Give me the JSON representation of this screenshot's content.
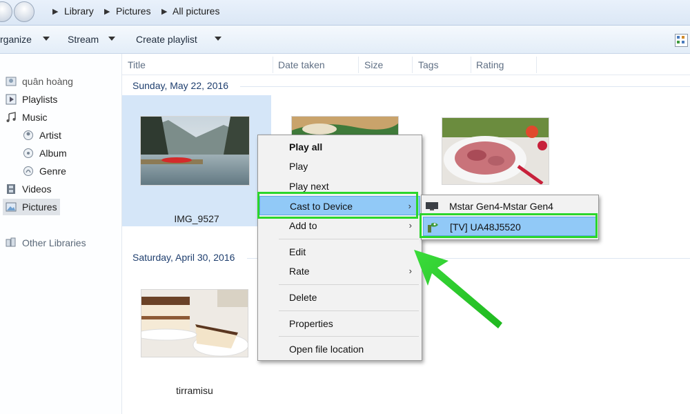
{
  "breadcrumb": [
    "Library",
    "Pictures",
    "All pictures"
  ],
  "toolbar": {
    "organize": "rganize",
    "stream": "Stream",
    "create_playlist": "Create playlist"
  },
  "sidebar": {
    "items": [
      {
        "label": "quân hoàng",
        "icon": "user-library-icon"
      },
      {
        "label": "Playlists",
        "icon": "playlist-icon"
      },
      {
        "label": "Music",
        "icon": "music-note-icon"
      },
      {
        "label": "Artist",
        "icon": "artist-icon"
      },
      {
        "label": "Album",
        "icon": "album-icon"
      },
      {
        "label": "Genre",
        "icon": "genre-icon"
      },
      {
        "label": "Videos",
        "icon": "film-icon"
      },
      {
        "label": "Pictures",
        "icon": "picture-icon"
      },
      {
        "label": "Other Libraries",
        "icon": "other-libraries-icon"
      }
    ]
  },
  "columns": [
    "Title",
    "Date taken",
    "Size",
    "Tags",
    "Rating"
  ],
  "groups": [
    {
      "date": "Sunday, May 22, 2016"
    },
    {
      "date": "Saturday, April 30, 2016"
    }
  ],
  "photos": [
    {
      "caption": "IMG_9527",
      "selected": true
    },
    {
      "caption": ""
    },
    {
      "caption": ""
    },
    {
      "caption": "tirramisu"
    }
  ],
  "context_menu": {
    "items": [
      "Play all",
      "Play",
      "Play next",
      "Cast to Device",
      "Add to",
      "Edit",
      "Rate",
      "Delete",
      "Properties",
      "Open file location"
    ],
    "submenu_arrow": "›"
  },
  "cast_submenu": {
    "items": [
      "Mstar Gen4-Mstar Gen4",
      "[TV] UA48J5520"
    ]
  },
  "colors": {
    "highlight": "#91c9f7",
    "annotation_green": "#2bd62b",
    "selection_tile": "#d5e6f8"
  }
}
